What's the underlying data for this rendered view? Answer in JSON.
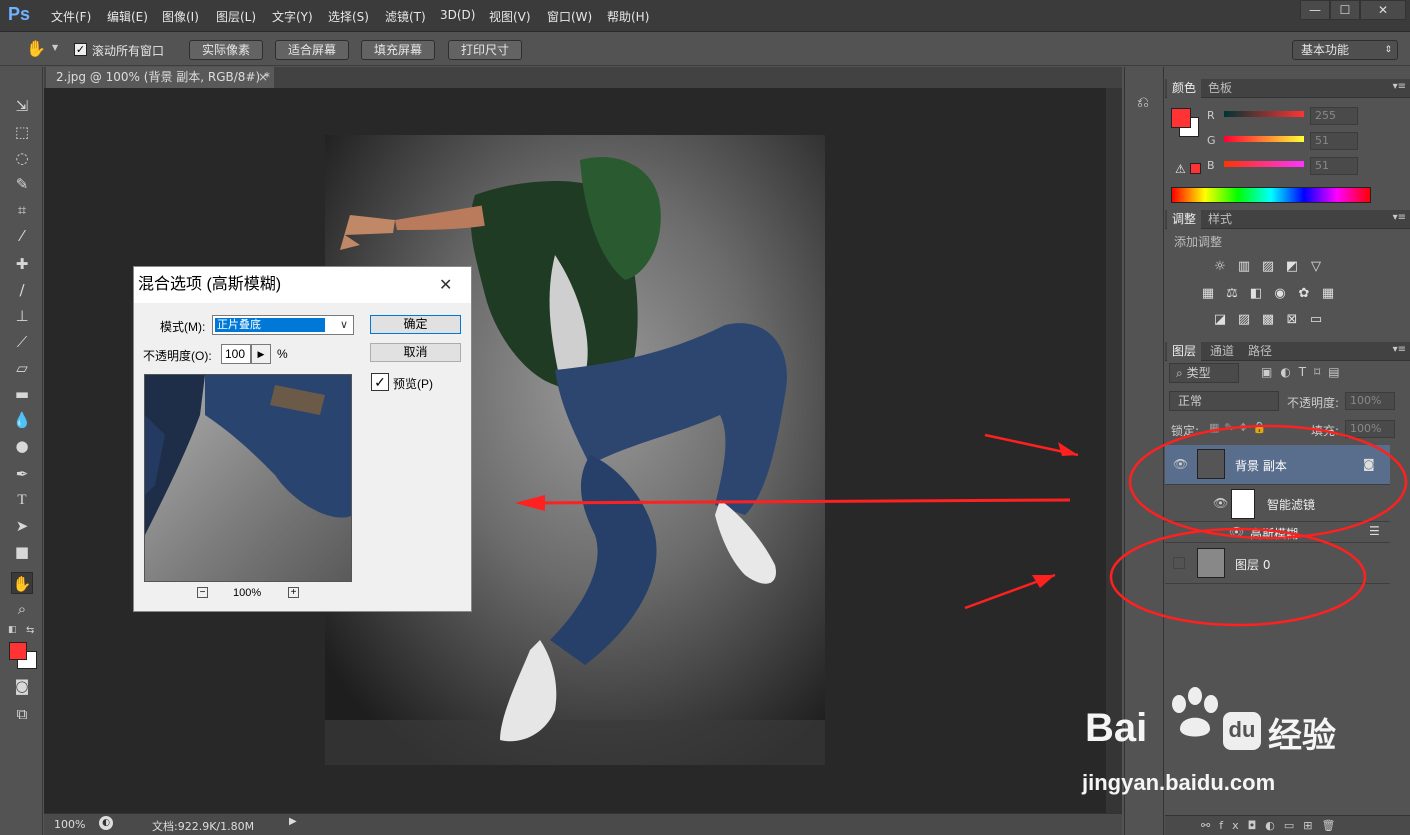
{
  "app": {
    "logo": "Ps"
  },
  "menu": [
    "文件(F)",
    "编辑(E)",
    "图像(I)",
    "图层(L)",
    "文字(Y)",
    "选择(S)",
    "滤镜(T)",
    "3D(D)",
    "视图(V)",
    "窗口(W)",
    "帮助(H)"
  ],
  "window_controls": {
    "minimize": "—",
    "maximize": "☐",
    "close": "✕"
  },
  "options": {
    "scroll_all_label": "滚动所有窗口",
    "btn_actual": "实际像素",
    "btn_fit": "适合屏幕",
    "btn_fill": "填充屏幕",
    "btn_print": "打印尺寸",
    "workspace": "基本功能"
  },
  "document": {
    "tab_title": "2.jpg @ 100% (背景 副本, RGB/8#) *",
    "tab_close": "×"
  },
  "status": {
    "zoom": "100%",
    "doc_info": "文档:922.9K/1.80M"
  },
  "color_panel": {
    "tab_color": "颜色",
    "tab_swatches": "色板",
    "r_label": "R",
    "g_label": "G",
    "b_label": "B",
    "r": "255",
    "g": "51",
    "b": "51",
    "fg_color": "#ff3333",
    "bg_color": "#ffffff"
  },
  "adjust_panel": {
    "tab_adjust": "调整",
    "tab_styles": "样式",
    "add_label": "添加调整"
  },
  "layers_panel": {
    "tab_layers": "图层",
    "tab_channels": "通道",
    "tab_paths": "路径",
    "filter_kind": "类型",
    "blend_mode": "正常",
    "opacity_label": "不透明度:",
    "opacity": "100%",
    "lock_label": "锁定:",
    "fill_label": "填充:",
    "fill": "100%",
    "layers": [
      {
        "name": "背景 副本"
      },
      {
        "name": "智能滤镜"
      },
      {
        "name": "高斯模糊"
      },
      {
        "name": "图层 0"
      }
    ]
  },
  "dialog": {
    "title": "混合选项 (高斯模糊)",
    "mode_label": "模式(M):",
    "mode_value": "正片叠底",
    "opacity_label": "不透明度(O):",
    "opacity_value": "100",
    "percent": "%",
    "ok": "确定",
    "cancel": "取消",
    "preview_label": "预览(P)",
    "zoom": "100%",
    "minus": "−",
    "plus": "+",
    "close": "✕"
  },
  "watermark": {
    "brand": "Bai",
    "brand2": "经验",
    "url": "jingyan.baidu.com"
  }
}
